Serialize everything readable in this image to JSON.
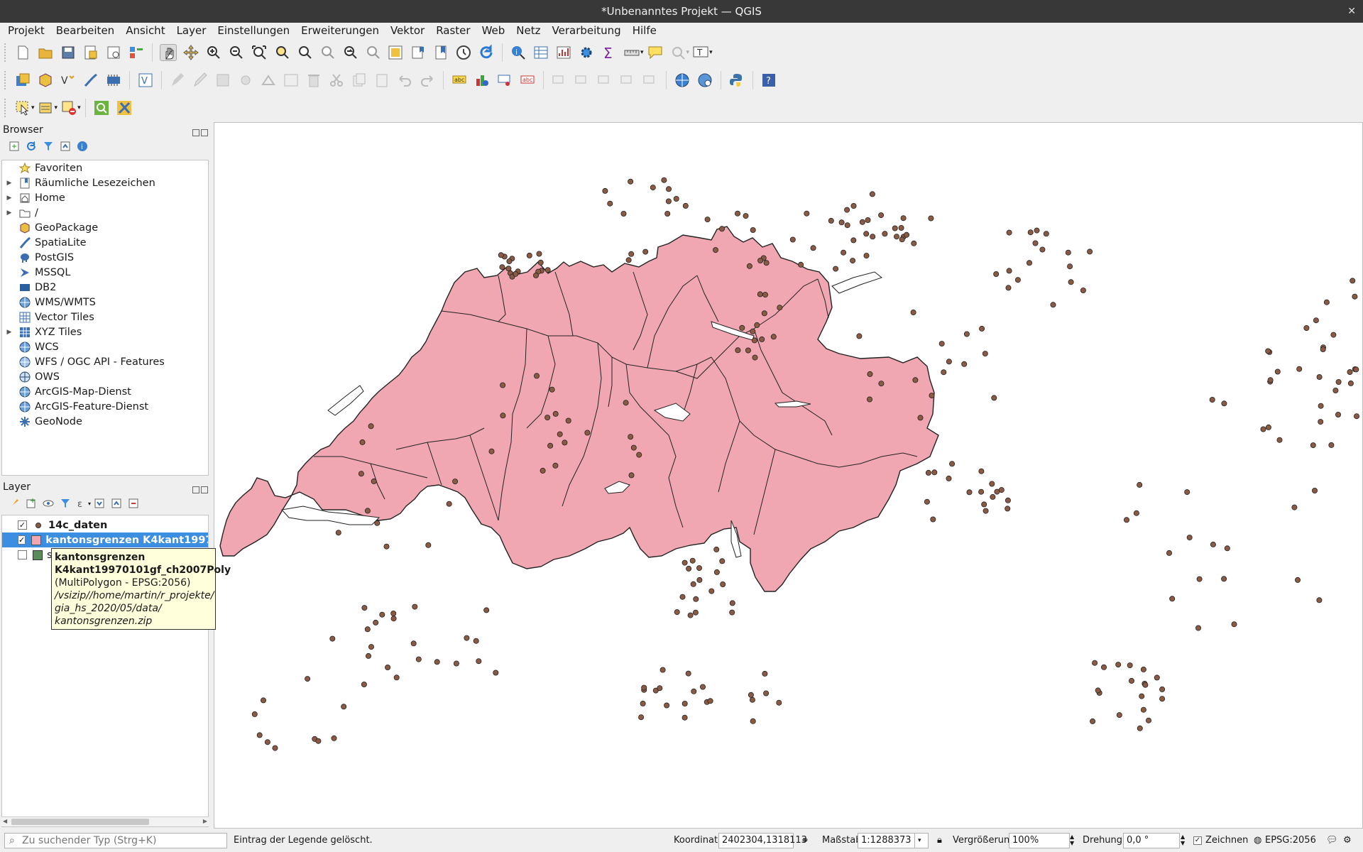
{
  "window": {
    "title": "*Unbenanntes Projekt — QGIS",
    "close": "✕"
  },
  "menu": [
    "Projekt",
    "Bearbeiten",
    "Ansicht",
    "Layer",
    "Einstellungen",
    "Erweiterungen",
    "Vektor",
    "Raster",
    "Web",
    "Netz",
    "Verarbeitung",
    "Hilfe"
  ],
  "browser": {
    "title": "Browser",
    "items": [
      {
        "label": "Favoriten",
        "icon": "star-icon",
        "expandable": false
      },
      {
        "label": "Räumliche Lesezeichen",
        "icon": "bookmark-icon",
        "expandable": true
      },
      {
        "label": "Home",
        "icon": "home-icon",
        "expandable": true
      },
      {
        "label": "/",
        "icon": "folder-icon",
        "expandable": true
      },
      {
        "label": "GeoPackage",
        "icon": "geopackage-icon",
        "expandable": false
      },
      {
        "label": "SpatiaLite",
        "icon": "feather-icon",
        "expandable": false
      },
      {
        "label": "PostGIS",
        "icon": "elephant-icon",
        "expandable": false
      },
      {
        "label": "MSSQL",
        "icon": "mssql-icon",
        "expandable": false
      },
      {
        "label": "DB2",
        "icon": "db2-icon",
        "expandable": false
      },
      {
        "label": "WMS/WMTS",
        "icon": "globe-icon",
        "expandable": false
      },
      {
        "label": "Vector Tiles",
        "icon": "grid-icon",
        "expandable": false
      },
      {
        "label": "XYZ Tiles",
        "icon": "grid-icon",
        "expandable": true
      },
      {
        "label": "WCS",
        "icon": "globe-icon",
        "expandable": false
      },
      {
        "label": "WFS / OGC API - Features",
        "icon": "globe-icon",
        "expandable": false
      },
      {
        "label": "OWS",
        "icon": "globe-icon",
        "expandable": false
      },
      {
        "label": "ArcGIS-Map-Dienst",
        "icon": "globe-icon",
        "expandable": false
      },
      {
        "label": "ArcGIS-Feature-Dienst",
        "icon": "globe-icon",
        "expandable": false
      },
      {
        "label": "GeoNode",
        "icon": "geonode-icon",
        "expandable": false
      }
    ]
  },
  "layers": {
    "title": "Layer",
    "items": [
      {
        "label": "14c_daten",
        "checked": true,
        "selected": false,
        "symbol": "point",
        "color": "#8b5a44"
      },
      {
        "label": "kantonsgrenzen K4kant19970101gf_ch2007Poly",
        "checked": true,
        "selected": true,
        "symbol": "polygon",
        "color": "#f1a7b2"
      },
      {
        "label": "swiss",
        "checked": false,
        "selected": false,
        "symbol": "raster",
        "color": "#5a8c5a"
      }
    ]
  },
  "tooltip": {
    "line1": "kantonsgrenzen",
    "line2": "K4kant19970101gf_ch2007Poly",
    "line3": "(MultiPolygon - EPSG:2056)",
    "line4": "/vsizip//home/martin/r_projekte/",
    "line5": "gia_hs_2020/05/data/",
    "line6": "kantonsgrenzen.zip"
  },
  "status": {
    "search_placeholder": "Zu suchender Typ (Strg+K)",
    "message": "Eintrag der Legende gelöscht.",
    "coord_label": "Koordinate",
    "coord_value": "2402304,1318113",
    "scale_label": "Maßstab",
    "scale_value": "1:1288373",
    "mag_label": "Vergrößerung",
    "mag_value": "100%",
    "rot_label": "Drehung",
    "rot_value": "0,0 °",
    "render_label": "Zeichnen",
    "crs": "EPSG:2056"
  },
  "colors": {
    "canton_fill": "#f1a7b2",
    "point_fill": "#8b5a44",
    "selection": "#3b8ee0"
  }
}
